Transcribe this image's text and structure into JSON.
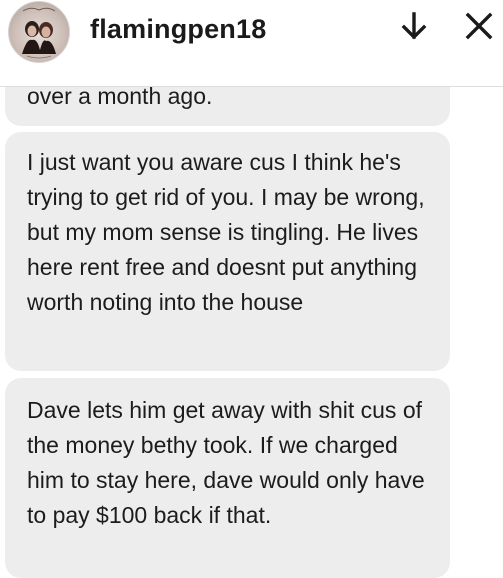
{
  "header": {
    "username": "flamingpen18",
    "avatar_icon": "profile-avatar",
    "scroll_down_icon": "arrow-down-icon",
    "close_icon": "close-icon"
  },
  "messages": [
    {
      "text": "over a month ago."
    },
    {
      "text": "I just want you aware cus I think he's trying to get rid of you. I may be wrong, but my mom sense is tingling. He lives here rent free and doesnt put anything worth noting into the house"
    },
    {
      "text": "Dave lets him get away with shit cus of the money bethy took. If we charged him to stay here, dave would only have to pay $100 back if that."
    }
  ],
  "colors": {
    "bubble_background": "#ededed",
    "text": "#1a1a1a",
    "header_background": "#ffffff"
  }
}
